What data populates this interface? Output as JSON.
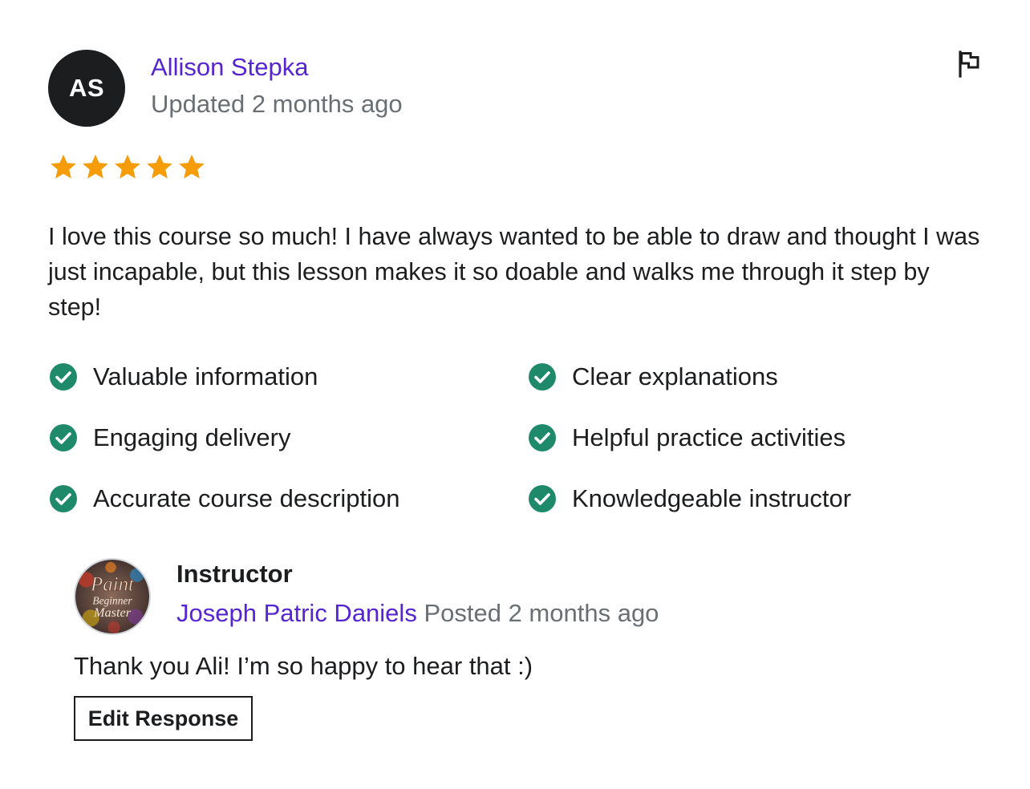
{
  "review": {
    "avatar_initials": "AS",
    "reviewer_name": "Allison Stepka",
    "updated": "Updated 2 months ago",
    "rating": 5,
    "rating_max": 5,
    "star_color": "#f69c08",
    "text": "I love this course so much! I have always wanted to be able to draw and thought I was just incapable, but this lesson makes it so doable and walks me through it step by step!",
    "tags": [
      {
        "label": "Valuable information",
        "icon": "check-circle-icon"
      },
      {
        "label": "Clear explanations",
        "icon": "check-circle-icon"
      },
      {
        "label": "Engaging delivery",
        "icon": "check-circle-icon"
      },
      {
        "label": "Helpful practice activities",
        "icon": "check-circle-icon"
      },
      {
        "label": "Accurate course description",
        "icon": "check-circle-icon"
      },
      {
        "label": "Knowledgeable instructor",
        "icon": "check-circle-icon"
      }
    ],
    "check_color": "#1e8a6a",
    "flag_icon": "flag-icon"
  },
  "response": {
    "role": "Instructor",
    "instructor_name": "Joseph Patric Daniels",
    "posted": "Posted 2 months ago",
    "avatar_logo_text": [
      "Paint",
      "Beginner",
      "Master"
    ],
    "text": "Thank you Ali! I’m so happy to hear that :)",
    "edit_button_label": "Edit Response"
  },
  "colors": {
    "link": "#5624d0",
    "muted": "#6a6f73",
    "text": "#1c1d1f"
  }
}
